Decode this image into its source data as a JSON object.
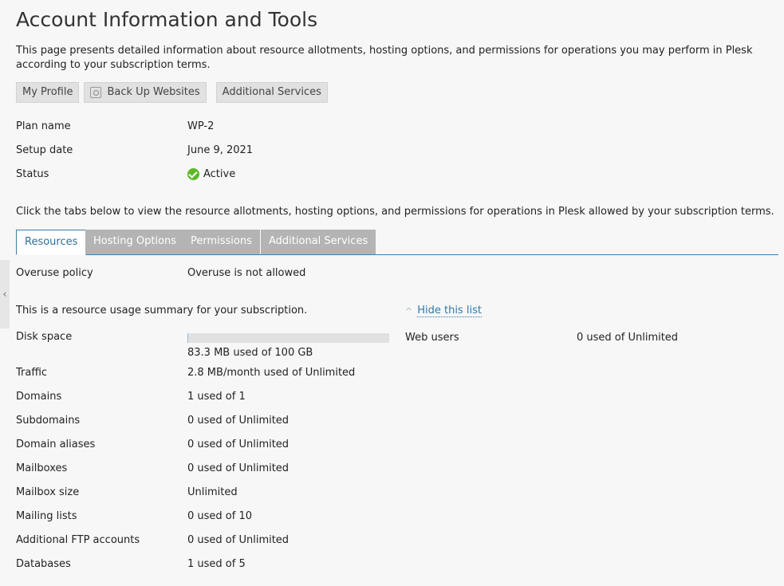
{
  "page": {
    "title": "Account Information and Tools",
    "intro": "This page presents detailed information about resource allotments, hosting options, and permissions for operations you may perform in Plesk according to your subscription terms."
  },
  "buttons": {
    "my_profile": "My Profile",
    "back_up": "Back Up Websites",
    "additional_services": "Additional Services"
  },
  "info": {
    "plan_name_label": "Plan name",
    "plan_name_value": "WP-2",
    "setup_date_label": "Setup date",
    "setup_date_value": "June 9, 2021",
    "status_label": "Status",
    "status_value": "Active"
  },
  "tabs_intro": "Click the tabs below to view the resource allotments, hosting options, and permissions for operations in Plesk allowed by your subscription terms.",
  "tabs": [
    "Resources",
    "Hosting Options",
    "Permissions",
    "Additional Services"
  ],
  "collapse_glyph": "‹",
  "overuse": {
    "label": "Overuse policy",
    "value": "Overuse is not allowed"
  },
  "summary": {
    "text": "This is a resource usage summary for your subscription.",
    "hide_link": "Hide this list",
    "hide_chevron": "^"
  },
  "disk": {
    "label": "Disk space",
    "value": "83.3 MB used of 100 GB",
    "fill_fraction": 0.0008
  },
  "web_users": {
    "label": "Web users",
    "value": "0 used of Unlimited"
  },
  "resources": [
    {
      "label": "Traffic",
      "value": "2.8 MB/month used of Unlimited"
    },
    {
      "label": "Domains",
      "value": "1 used of 1"
    },
    {
      "label": "Subdomains",
      "value": "0 used of Unlimited"
    },
    {
      "label": "Domain aliases",
      "value": "0 used of Unlimited"
    },
    {
      "label": "Mailboxes",
      "value": "0 used of Unlimited"
    },
    {
      "label": "Mailbox size",
      "value": "Unlimited"
    },
    {
      "label": "Mailing lists",
      "value": "0 used of 10"
    },
    {
      "label": "Additional FTP accounts",
      "value": "0 used of Unlimited"
    },
    {
      "label": "Databases",
      "value": "1 used of 5"
    }
  ],
  "colors": {
    "accent": "#3b7fa6",
    "active_green": "#5db82a",
    "tab_inactive": "#b4b4b4"
  }
}
